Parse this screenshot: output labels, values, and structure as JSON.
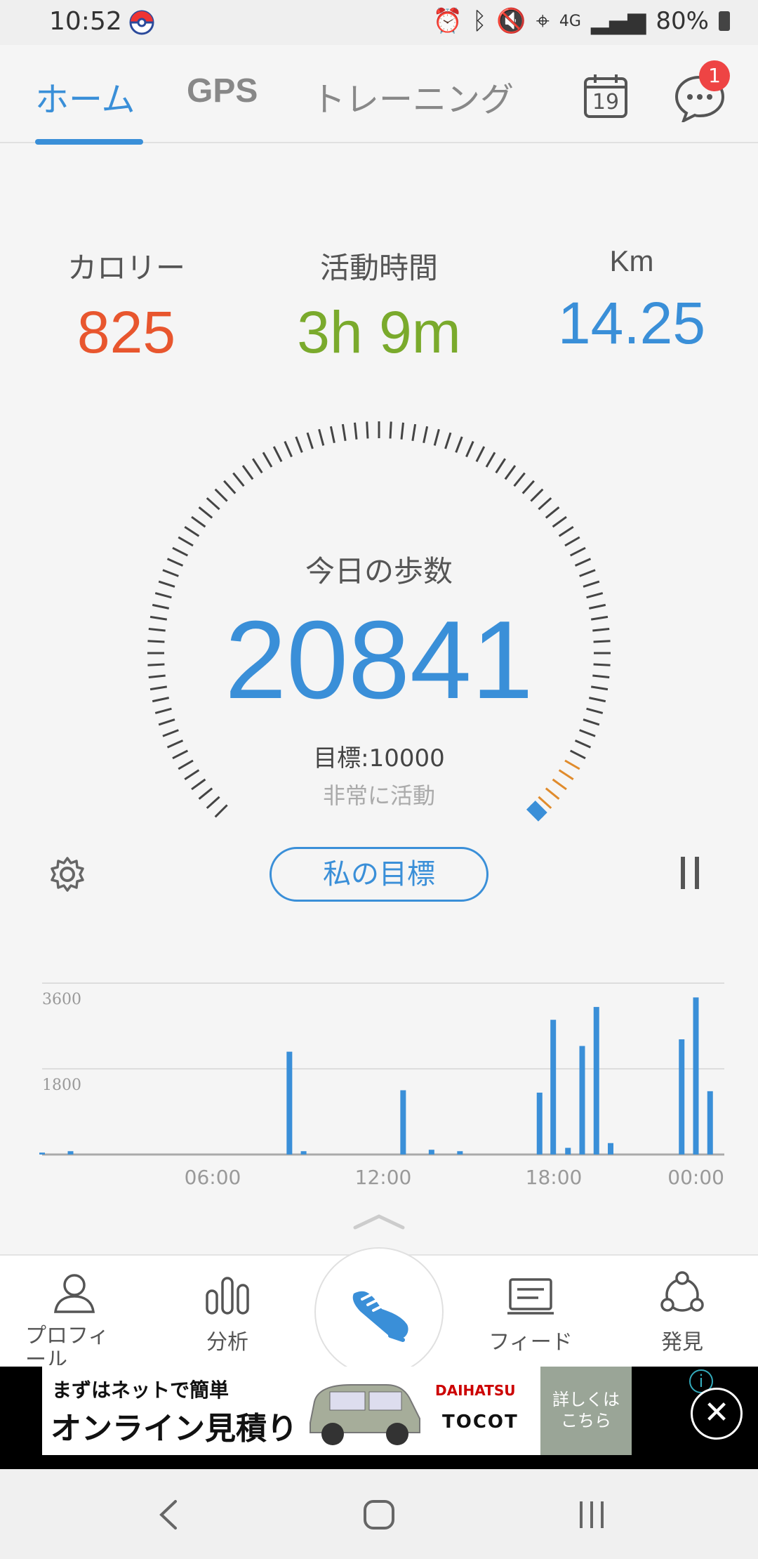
{
  "status": {
    "time": "10:52",
    "signal": "4G",
    "battery": "80%"
  },
  "tabs": [
    {
      "label": "ホーム",
      "active": true
    },
    {
      "label": "GPS",
      "active": false
    },
    {
      "label": "トレーニング",
      "active": false
    }
  ],
  "header": {
    "calendar_day": "19",
    "message_badge": "1"
  },
  "stats": {
    "calories": {
      "label": "カロリー",
      "value": "825",
      "color": "#e8562e"
    },
    "active_time": {
      "label": "活動時間",
      "value": "3h 9m",
      "color": "#7aaa2c"
    },
    "distance": {
      "label": "Km",
      "value": "14.25",
      "color": "#3a8fd8"
    }
  },
  "steps": {
    "title": "今日の歩数",
    "count": "20841",
    "goal_text": "目標:10000",
    "level": "非常に活動",
    "goal_button": "私の目標",
    "progress": 1.0
  },
  "chart_data": {
    "type": "bar",
    "y_ticks": [
      "3600",
      "1800"
    ],
    "x_ticks": [
      "06:00",
      "12:00",
      "18:00",
      "00:00"
    ],
    "ylim": [
      0,
      3600
    ],
    "x": [
      0.0,
      1.0,
      8.7,
      9.2,
      12.7,
      13.7,
      14.7,
      17.5,
      17.98,
      18.5,
      19.0,
      19.5,
      20.0,
      22.5,
      23.0,
      23.5
    ],
    "values": [
      40,
      70,
      2160,
      70,
      1350,
      100,
      70,
      1300,
      2830,
      140,
      2280,
      3100,
      240,
      2420,
      3300,
      1330
    ]
  },
  "bottom_nav": [
    {
      "label": "プロフィール"
    },
    {
      "label": "分析"
    },
    {
      "label": "フィード"
    },
    {
      "label": "発見"
    }
  ],
  "ad": {
    "line1": "まずはネットで簡単",
    "line2": "オンライン見積り",
    "brand": "DAIHATSU",
    "model": "TOCOT",
    "cta": "詳しくは\nこちら"
  },
  "colors": {
    "accent": "#3a8fd8",
    "warning": "#e08b2c"
  }
}
